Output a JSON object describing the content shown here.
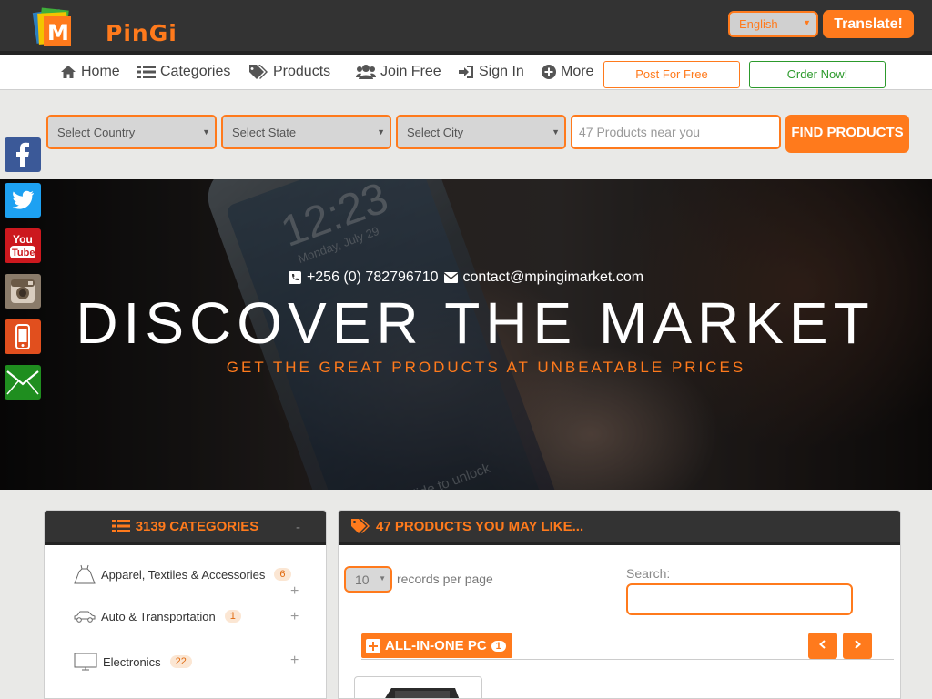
{
  "brand": {
    "name": "MPinGi",
    "logo_text": "PinGi",
    "logo_letter": "M"
  },
  "language": {
    "selected": "English"
  },
  "translate_label": "Translate!",
  "nav": {
    "items": [
      {
        "label": "Home",
        "icon": "home-icon"
      },
      {
        "label": "Categories",
        "icon": "list-icon"
      },
      {
        "label": "Products",
        "icon": "tags-icon"
      },
      {
        "label": "Join Free",
        "icon": "users-icon"
      },
      {
        "label": "Sign In",
        "icon": "sign-in-icon"
      },
      {
        "label": "More",
        "icon": "plus-circle-icon"
      }
    ],
    "post_label": "Post For Free",
    "order_label": "Order Now!"
  },
  "search": {
    "country_placeholder": "Select Country",
    "state_placeholder": "Select State",
    "city_placeholder": "Select City",
    "products_placeholder": "47 Products near you",
    "find_label": "FIND PRODUCTS"
  },
  "social": [
    "facebook-icon",
    "twitter-icon",
    "youtube-icon",
    "instagram-icon",
    "phone-icon",
    "email-icon"
  ],
  "hero": {
    "phone_text": "+256 (0) 782796710",
    "email_text": "contact@mpingimarket.com",
    "title": "DISCOVER THE MARKET",
    "subtitle": "GET THE GREAT PRODUCTS AT UNBEATABLE PRICES",
    "phone_screen_time": "12:23",
    "phone_screen_date": "Monday, July 29",
    "phone_screen_slide": "slide to unlock"
  },
  "categories": {
    "title": "3139 CATEGORIES",
    "collapse_label": "-",
    "items": [
      {
        "label": "Apparel, Textiles & Accessories",
        "count": "6",
        "icon": "dress-icon"
      },
      {
        "label": "Auto & Transportation",
        "count": "1",
        "icon": "car-icon"
      },
      {
        "label": "Electronics",
        "count": "22",
        "icon": "monitor-icon"
      }
    ],
    "expand_label": "+"
  },
  "products": {
    "title": "47 PRODUCTS YOU MAY LIKE...",
    "per_page": "10",
    "per_page_label": "records per page",
    "search_label": "Search:",
    "group_label": "ALL-IN-ONE PC",
    "group_count": "1",
    "prev_icon": "chevron-left-icon",
    "next_icon": "chevron-right-icon"
  },
  "colors": {
    "accent": "#ff7a1c",
    "dark": "#333333",
    "green": "#2c9a2c"
  }
}
